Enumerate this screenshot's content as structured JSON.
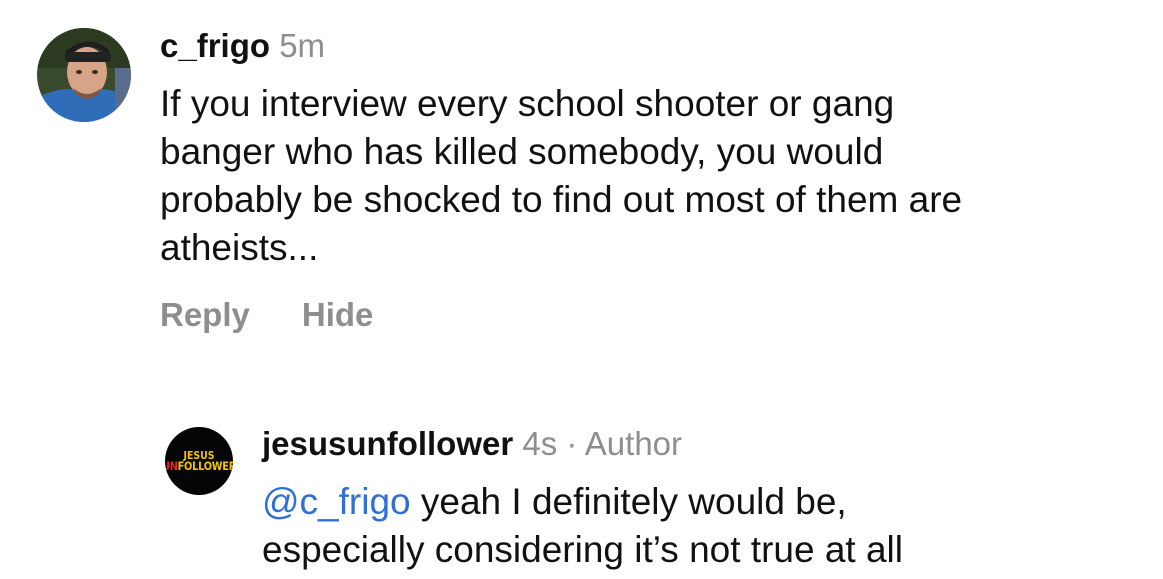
{
  "comment": {
    "username": "c_frigo",
    "time": "5m",
    "text_lines": [
      "If you interview every school shooter or gang",
      "banger who has killed somebody, you would",
      "probably be shocked to find out most of them are",
      "atheists..."
    ],
    "actions": {
      "reply": "Reply",
      "hide": "Hide"
    }
  },
  "reply": {
    "username": "jesusunfollower",
    "time": "4s",
    "separator": "·",
    "badge": "Author",
    "mention": "@c_frigo",
    "text_line1": " yeah I definitely would be,",
    "text_line2": "especially considering it’s not true at all",
    "avatar_logo": {
      "line1": "JESUS",
      "line2_red": "UN",
      "line2_yellow": "FOLLOWER"
    }
  },
  "colors": {
    "meta_gray": "#8e8e8e",
    "mention_blue": "#2f6fd6",
    "logo_yellow": "#f5c400",
    "logo_red": "#e8261b"
  }
}
